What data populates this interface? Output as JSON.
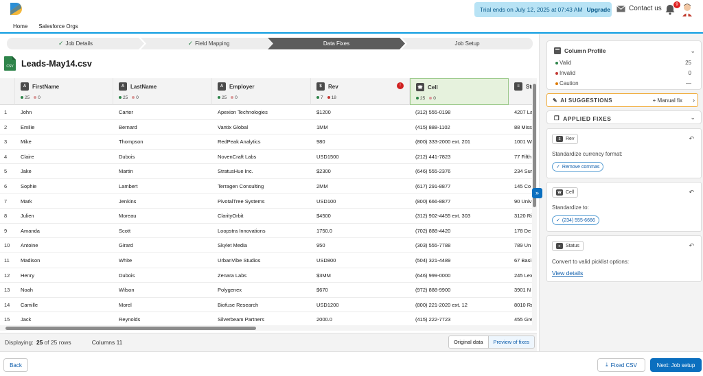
{
  "topbar": {
    "trial_text": "Trial ends on July 12, 2025 at 07:43 AM",
    "upgrade_label": "Upgrade",
    "contact_label": "Contact us",
    "notifications_count": "9"
  },
  "nav": {
    "items": [
      "Home",
      "Salesforce Orgs"
    ]
  },
  "stepper": {
    "steps": [
      {
        "label": "Job Details",
        "state": "done"
      },
      {
        "label": "Field Mapping",
        "state": "done"
      },
      {
        "label": "Data Fixes",
        "state": "active"
      },
      {
        "label": "Job Setup",
        "state": "todo"
      }
    ]
  },
  "file": {
    "icon_label": "CSV",
    "title": "Leads-May14.csv"
  },
  "grid": {
    "columns": [
      {
        "name": "FirstName",
        "icon": "text-icon",
        "icon_glyph": "A",
        "valid": "25",
        "invalid": "0"
      },
      {
        "name": "LastName",
        "icon": "text-icon",
        "icon_glyph": "A",
        "valid": "25",
        "invalid": "0"
      },
      {
        "name": "Employer",
        "icon": "text-icon",
        "icon_glyph": "A",
        "valid": "25",
        "invalid": "0"
      },
      {
        "name": "Rev",
        "icon": "currency-icon",
        "icon_glyph": "$",
        "valid": "7",
        "invalid": "18",
        "error": "!"
      },
      {
        "name": "Cell",
        "icon": "phone-icon",
        "icon_glyph": "☎",
        "valid": "25",
        "invalid": "0"
      },
      {
        "name": "Str",
        "icon": "text-icon",
        "icon_glyph": "≡",
        "valid": "",
        "invalid": ""
      }
    ],
    "rows": [
      [
        "1",
        "John",
        "Carter",
        "Apexion Technologies",
        "$1200",
        "(312) 555-0198",
        "4207 La"
      ],
      [
        "2",
        "Emilie",
        "Bernard",
        "Vantix Global",
        "1MM",
        "(415) 888-1102",
        "88 Miss"
      ],
      [
        "3",
        "Mike",
        "Thompson",
        "RedPeak Analytics",
        "980",
        "(800) 333-2000 ext. 201",
        "1001 W"
      ],
      [
        "4",
        "Claire",
        "Dubois",
        "NovenCraft Labs",
        "USD1500",
        "(212) 441-7823",
        "77 Fifth"
      ],
      [
        "5",
        "Jake",
        "Martin",
        "StratusHue Inc.",
        "$2300",
        "(646) 555-2376",
        "234 Sur"
      ],
      [
        "6",
        "Sophie",
        "Lambert",
        "Terragen Consulting",
        "2MM",
        "(617) 291-8877",
        "145 Co"
      ],
      [
        "7",
        "Mark",
        "Jenkins",
        "PivotalTree Systems",
        "USD100",
        "(800) 666-8877",
        "90 Univ"
      ],
      [
        "8",
        "Julien",
        "Moreau",
        "ClarityOrbit",
        "$4500",
        "(312) 902-4455 ext. 303",
        "3120 Ri"
      ],
      [
        "9",
        "Amanda",
        "Scott",
        "Loopstra Innovations",
        "1750.0",
        "(702) 888-4420",
        "178 De"
      ],
      [
        "10",
        "Antoine",
        "Girard",
        "Skylet Media",
        "950",
        "(303) 555-7788",
        "789 Un"
      ],
      [
        "11",
        "Madison",
        "White",
        "UrbanVibe Studios",
        "USD800",
        "(504) 321-4489",
        "67 Basi"
      ],
      [
        "12",
        "Henry",
        "Dubois",
        "Zenara Labs",
        "$3MM",
        "(646) 999-0000",
        "245 Lex"
      ],
      [
        "13",
        "Noah",
        "Wilson",
        "Polygenex",
        "$670",
        "(972) 888-9900",
        "3901 N"
      ],
      [
        "14",
        "Camille",
        "Morel",
        "Biofuse Research",
        "USD1200",
        "(800) 221-2020 ext. 12",
        "8010 Re"
      ],
      [
        "15",
        "Jack",
        "Reynolds",
        "Silverbeam Partners",
        "2000.0",
        "(415) 222-7723",
        "455 Gre"
      ]
    ]
  },
  "footer": {
    "displaying_label": "Displaying:",
    "displayed": "25",
    "of_label": "of",
    "total": "25",
    "rows_label": "rows",
    "columns_text": "Columns 11",
    "original_label": "Original data",
    "preview_label": "Preview of fixes"
  },
  "panel": {
    "profile": {
      "title": "Column Profile",
      "rows": [
        {
          "label": "Valid",
          "value": "25",
          "color": "#2e844a"
        },
        {
          "label": "Invalid",
          "value": "0",
          "color": "#c23934"
        },
        {
          "label": "Caution",
          "value": "—",
          "color": "#dd7a01"
        }
      ]
    },
    "ai": {
      "title": "AI SUGGESTIONS",
      "manual_label": "+ Manual fix"
    },
    "applied": {
      "title": "APPLIED FIXES",
      "fixes": [
        {
          "chip": "Rev",
          "icon": "currency-icon",
          "glyph": "$",
          "desc": "Standardize currency format:",
          "pill": "Remove commas"
        },
        {
          "chip": "Cell",
          "icon": "phone-icon",
          "glyph": "☎",
          "desc": "Standardize to:",
          "pill": "(234) 555-6666"
        },
        {
          "chip": "Status",
          "icon": "picklist-icon",
          "glyph": "≡",
          "desc": "Convert to valid picklist options:",
          "link": "View details"
        }
      ]
    }
  },
  "actions": {
    "back_label": "Back",
    "fixed_csv_label": "Fixed CSV",
    "next_label": "Next: Job setup"
  }
}
